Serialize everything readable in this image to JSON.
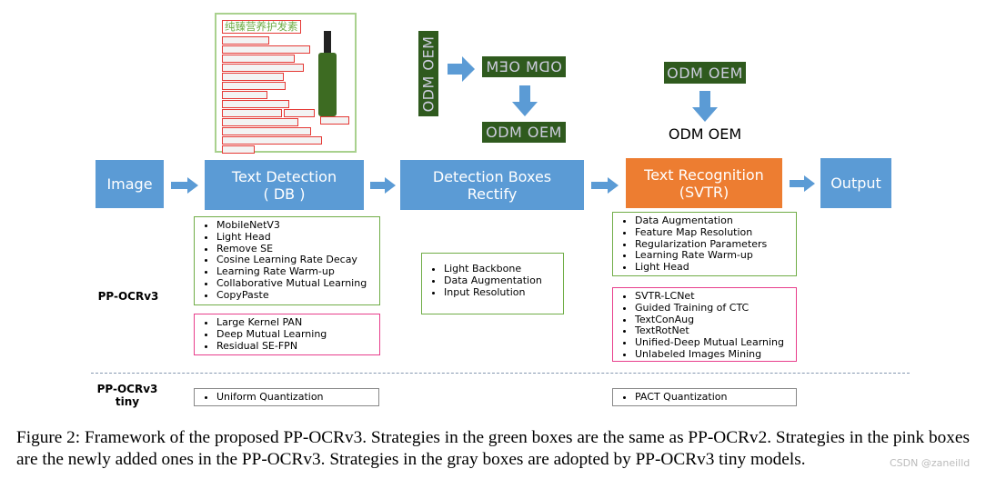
{
  "pipeline": {
    "image": "Image",
    "detection": {
      "title": "Text Detection",
      "sub": "( DB )"
    },
    "rectify": {
      "title": "Detection Boxes",
      "sub": "Rectify"
    },
    "recognition": {
      "title": "Text Recognition",
      "sub": "(SVTR)"
    },
    "output": "Output"
  },
  "examples": {
    "product_title": "纯臻营养护发素",
    "crop_text": "ODM OEM",
    "result_text": "ODM OEM"
  },
  "rows": {
    "v3_label": "PP-OCRv3",
    "tiny_label": "PP-OCRv3 tiny"
  },
  "det_green": [
    "MobileNetV3",
    "Light Head",
    "Remove SE",
    "Cosine Learning Rate Decay",
    "Learning Rate Warm-up",
    "Collaborative Mutual Learning",
    "CopyPaste"
  ],
  "det_pink": [
    "Large Kernel PAN",
    "Deep Mutual Learning",
    "Residual SE-FPN"
  ],
  "rect_green": [
    "Light Backbone",
    "Data Augmentation",
    "Input Resolution"
  ],
  "rec_green": [
    "Data Augmentation",
    "Feature Map Resolution",
    "Regularization Parameters",
    "Learning Rate Warm-up",
    "Light Head"
  ],
  "rec_pink": [
    "SVTR-LCNet",
    "Guided Training of CTC",
    "TextConAug",
    "TextRotNet",
    "Unified-Deep Mutual Learning",
    "Unlabeled Images Mining"
  ],
  "det_gray": [
    "Uniform Quantization"
  ],
  "rec_gray": [
    "PACT Quantization"
  ],
  "caption": "Figure 2: Framework of the proposed PP-OCRv3. Strategies in the green boxes are the same as PP-OCRv2. Strategies in the pink boxes are the newly added ones in the PP-OCRv3. Strategies in the gray boxes are adopted by PP-OCRv3 tiny models.",
  "watermark": "CSDN @zaneilld",
  "colors": {
    "blue": "#5b9bd5",
    "orange": "#ed7d31",
    "green": "#70ad47",
    "pink": "#e83e8c",
    "gray": "#888888"
  }
}
